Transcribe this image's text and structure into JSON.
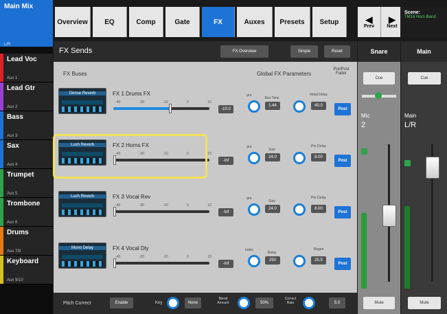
{
  "sidebar": {
    "main_mix": {
      "title": "Main Mix",
      "sub": "L/R"
    },
    "channels": [
      {
        "name": "Lead Voc",
        "aux": "Aux 1",
        "color": "#e0202a"
      },
      {
        "name": "Lead Gtr",
        "aux": "Aux 2",
        "color": "#9a3fd6"
      },
      {
        "name": "Bass",
        "aux": "Aux 3",
        "color": "#1e73d6"
      },
      {
        "name": "Sax",
        "aux": "Aux 4",
        "color": "#1e73d6"
      },
      {
        "name": "Trumpet",
        "aux": "Aux 5",
        "color": "#2fa34b"
      },
      {
        "name": "Trombone",
        "aux": "Aux 6",
        "color": "#2fa34b"
      },
      {
        "name": "Drums",
        "aux": "Aux 7/8",
        "color": "#e57a14"
      },
      {
        "name": "Keyboard",
        "aux": "Aux 9/10",
        "color": "#d6c21e"
      }
    ]
  },
  "topnav": {
    "tabs": [
      "Overview",
      "EQ",
      "Comp",
      "Gate",
      "FX",
      "Auxes",
      "Presets",
      "Setup"
    ],
    "prev": "Prev",
    "next": "Next",
    "scene_label": "Scene:",
    "scene_name": "TM16 Horn Band"
  },
  "fx_panel": {
    "title": "FX Sends",
    "overview_btn": "FX Overview",
    "simple_btn": "Simple",
    "reset_btn": "Reset",
    "buses_label": "FX Buses",
    "global_label": "Global FX Parameters",
    "prepost_label": "Pre/Post Fader",
    "ticks": [
      "-40",
      "-20",
      "-10",
      "0",
      "10"
    ],
    "buses": [
      {
        "preset": "Dense Reverb",
        "name": "FX 1  Drums FX",
        "send": "-10.0",
        "send_level": 0.58,
        "p1_label": "pre",
        "p1_name": "Rev Time",
        "p1_val": "1.44",
        "p2_label": "Initial Delay",
        "p2_val": "40.0",
        "post": "Post"
      },
      {
        "preset": "Lush Reverb",
        "name": "FX 2  Horns FX",
        "send": "-Inf",
        "send_level": 0.0,
        "p1_label": "pre",
        "p1_name": "Size",
        "p1_val": "24.0",
        "p2_label": "Pre Delay",
        "p2_val": "8.00",
        "post": "Post"
      },
      {
        "preset": "Lush Reverb",
        "name": "FX 3  Vocal Rev",
        "send": "-Inf",
        "send_level": 0.0,
        "p1_label": "pre",
        "p1_name": "Size",
        "p1_val": "24.0",
        "p2_label": "Pre Delay",
        "p2_val": "8.00",
        "post": "Post"
      },
      {
        "preset": "Mono Delay",
        "name": "FX 4  Vocal Dly",
        "send": "-Inf",
        "send_level": 0.0,
        "p1_label": "mdec",
        "p1_name": "Delay",
        "p1_val": "250",
        "p2_label": "Regen",
        "p2_val": "25.5",
        "post": "Post"
      }
    ],
    "bottom": {
      "pitch_label": "Pitch Correct",
      "enable": "Enable",
      "key_label": "Key",
      "key_val": "None",
      "blend_label": "Blend Amount",
      "blend_val": "50%",
      "correct_label": "Correct Rate",
      "correct_val": "5.0"
    }
  },
  "snare_strip": {
    "title": "Snare",
    "cue": "Cue",
    "ch_name": "Mic",
    "ch_num": "2",
    "mute": "Mute"
  },
  "main_strip": {
    "title": "Main",
    "cue": "Cue",
    "ch_name": "Main",
    "ch_sub": "L/R",
    "mute": "Mute"
  }
}
